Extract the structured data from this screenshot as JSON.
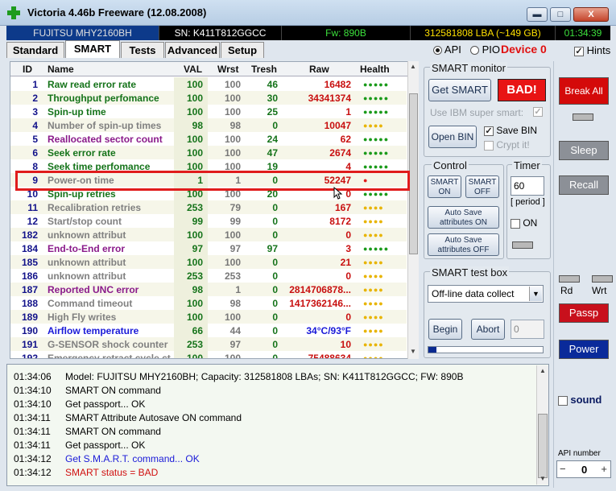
{
  "window": {
    "title": "Victoria 4.46b Freeware (12.08.2008)",
    "min_icon": "minimize-icon",
    "max_icon": "maximize-icon",
    "close_label": "X"
  },
  "infobar": {
    "model": "FUJITSU MHY2160BH",
    "serial": "SN: K411T812GGCC",
    "firmware": "Fw: 890B",
    "lba": "312581808 LBA (~149 GB)",
    "clock": "01:34:39"
  },
  "tabs": [
    "Standard",
    "SMART",
    "Tests",
    "Advanced",
    "Setup"
  ],
  "mode": {
    "api": "API",
    "pio": "PIO",
    "device": "Device 0",
    "hints": "Hints"
  },
  "table": {
    "headers": [
      "ID",
      "Name",
      "VAL",
      "Wrst",
      "Tresh",
      "Raw",
      "Health"
    ],
    "rows": [
      {
        "id": "1",
        "name": "Raw read error rate",
        "val": "100",
        "wrst": "100",
        "tresh": "46",
        "raw": "16482",
        "health": "●●●●●",
        "color": "#15731a",
        "hcolor": "#1a9a1a"
      },
      {
        "id": "2",
        "name": "Throughput perfomance",
        "val": "100",
        "wrst": "100",
        "tresh": "30",
        "raw": "34341374",
        "health": "●●●●●",
        "color": "#15731a",
        "hcolor": "#1a9a1a"
      },
      {
        "id": "3",
        "name": "Spin-up time",
        "val": "100",
        "wrst": "100",
        "tresh": "25",
        "raw": "1",
        "health": "●●●●●",
        "color": "#15731a",
        "hcolor": "#1a9a1a"
      },
      {
        "id": "4",
        "name": "Number of spin-up times",
        "val": "98",
        "wrst": "98",
        "tresh": "0",
        "raw": "10047",
        "health": "●●●●",
        "color": "#808080",
        "hcolor": "#e8b400"
      },
      {
        "id": "5",
        "name": "Reallocated sector count",
        "val": "100",
        "wrst": "100",
        "tresh": "24",
        "raw": "62",
        "health": "●●●●●",
        "color": "#8a1a8a",
        "hcolor": "#1a9a1a"
      },
      {
        "id": "6",
        "name": "Seek error rate",
        "val": "100",
        "wrst": "100",
        "tresh": "47",
        "raw": "2674",
        "health": "●●●●●",
        "color": "#15731a",
        "hcolor": "#1a9a1a"
      },
      {
        "id": "8",
        "name": "Seek time perfomance",
        "val": "100",
        "wrst": "100",
        "tresh": "19",
        "raw": "4",
        "health": "●●●●●",
        "color": "#15731a",
        "hcolor": "#1a9a1a"
      },
      {
        "id": "9",
        "name": "Power-on time",
        "val": "1",
        "wrst": "1",
        "tresh": "0",
        "raw": "52247",
        "health": "●",
        "color": "#808080",
        "hcolor": "#e01c1c"
      },
      {
        "id": "10",
        "name": "Spin-up retries",
        "val": "100",
        "wrst": "100",
        "tresh": "20",
        "raw": "0",
        "health": "●●●●●",
        "color": "#15731a",
        "hcolor": "#1a9a1a"
      },
      {
        "id": "11",
        "name": "Recalibration retries",
        "val": "253",
        "wrst": "79",
        "tresh": "0",
        "raw": "167",
        "health": "●●●●",
        "color": "#808080",
        "hcolor": "#e8b400"
      },
      {
        "id": "12",
        "name": "Start/stop count",
        "val": "99",
        "wrst": "99",
        "tresh": "0",
        "raw": "8172",
        "health": "●●●●",
        "color": "#808080",
        "hcolor": "#e8b400"
      },
      {
        "id": "182",
        "name": "unknown attribut",
        "val": "100",
        "wrst": "100",
        "tresh": "0",
        "raw": "0",
        "health": "●●●●",
        "color": "#808080",
        "hcolor": "#e8b400"
      },
      {
        "id": "184",
        "name": "End-to-End error",
        "val": "97",
        "wrst": "97",
        "tresh": "97",
        "raw": "3",
        "health": "●●●●●",
        "color": "#8a1a8a",
        "hcolor": "#1a9a1a"
      },
      {
        "id": "185",
        "name": "unknown attribut",
        "val": "100",
        "wrst": "100",
        "tresh": "0",
        "raw": "21",
        "health": "●●●●",
        "color": "#808080",
        "hcolor": "#e8b400"
      },
      {
        "id": "186",
        "name": "unknown attribut",
        "val": "253",
        "wrst": "253",
        "tresh": "0",
        "raw": "0",
        "health": "●●●●",
        "color": "#808080",
        "hcolor": "#e8b400"
      },
      {
        "id": "187",
        "name": "Reported UNC error",
        "val": "98",
        "wrst": "1",
        "tresh": "0",
        "raw": "2814706878...",
        "health": "●●●●",
        "color": "#8a1a8a",
        "hcolor": "#e8b400"
      },
      {
        "id": "188",
        "name": "Command timeout",
        "val": "100",
        "wrst": "98",
        "tresh": "0",
        "raw": "1417362146...",
        "health": "●●●●",
        "color": "#808080",
        "hcolor": "#e8b400"
      },
      {
        "id": "189",
        "name": "High Fly writes",
        "val": "100",
        "wrst": "100",
        "tresh": "0",
        "raw": "0",
        "health": "●●●●",
        "color": "#808080",
        "hcolor": "#e8b400"
      },
      {
        "id": "190",
        "name": "Airflow temperature",
        "val": "66",
        "wrst": "44",
        "tresh": "0",
        "raw": "34°C/93°F",
        "health": "●●●●",
        "color": "#1a1ad8",
        "hcolor": "#e8b400",
        "rawcolor": "#1a1ad8"
      },
      {
        "id": "191",
        "name": "G-SENSOR shock counter",
        "val": "253",
        "wrst": "97",
        "tresh": "0",
        "raw": "10",
        "health": "●●●●",
        "color": "#808080",
        "hcolor": "#e8b400"
      },
      {
        "id": "192",
        "name": "Emergency retract cycle ct",
        "val": "100",
        "wrst": "100",
        "tresh": "0",
        "raw": "75488634",
        "health": "●●●●",
        "color": "#808080",
        "hcolor": "#e8b400"
      }
    ]
  },
  "smart_monitor": {
    "title": "SMART monitor",
    "get_smart": "Get SMART",
    "status": "BAD!",
    "ibm_label": "Use IBM super smart:",
    "open_bin": "Open BIN",
    "save_bin": "Save BIN",
    "crypt": "Crypt it!"
  },
  "control": {
    "title": "Control",
    "smart_on": "SMART ON",
    "smart_off": "SMART OFF",
    "autosave_on": "Auto Save attributes ON",
    "autosave_off": "Auto Save attributes OFF"
  },
  "timer": {
    "title": "Timer",
    "value": "60",
    "period": "[ period ]",
    "on": "ON"
  },
  "test_box": {
    "title": "SMART test box",
    "selected": "Off-line data collect",
    "begin": "Begin",
    "abort": "Abort",
    "progress": "0"
  },
  "right_panel": {
    "break_all": "Break All",
    "sleep": "Sleep",
    "recall": "Recall",
    "rd": "Rd",
    "wrt": "Wrt",
    "passp": "Passp",
    "power": "Power",
    "sound": "sound",
    "api_label": "API number",
    "api_value": "0",
    "minus": "−",
    "plus": "+"
  },
  "log": [
    {
      "time": "01:34:06",
      "msg": "Model: FUJITSU MHY2160BH; Capacity: 312581808 LBAs; SN: K411T812GGCC; FW: 890B",
      "color": "#000000"
    },
    {
      "time": "01:34:10",
      "msg": "SMART ON command",
      "color": "#000000"
    },
    {
      "time": "01:34:10",
      "msg": "Get passport... OK",
      "color": "#000000"
    },
    {
      "time": "01:34:11",
      "msg": "SMART Attribute Autosave ON command",
      "color": "#000000"
    },
    {
      "time": "01:34:11",
      "msg": "SMART ON command",
      "color": "#000000"
    },
    {
      "time": "01:34:11",
      "msg": "Get passport... OK",
      "color": "#000000"
    },
    {
      "time": "01:34:12",
      "msg": "Get S.M.A.R.T. command... OK",
      "color": "#1a1ad8"
    },
    {
      "time": "01:34:12",
      "msg": "SMART status = BAD",
      "color": "#d01010"
    }
  ]
}
